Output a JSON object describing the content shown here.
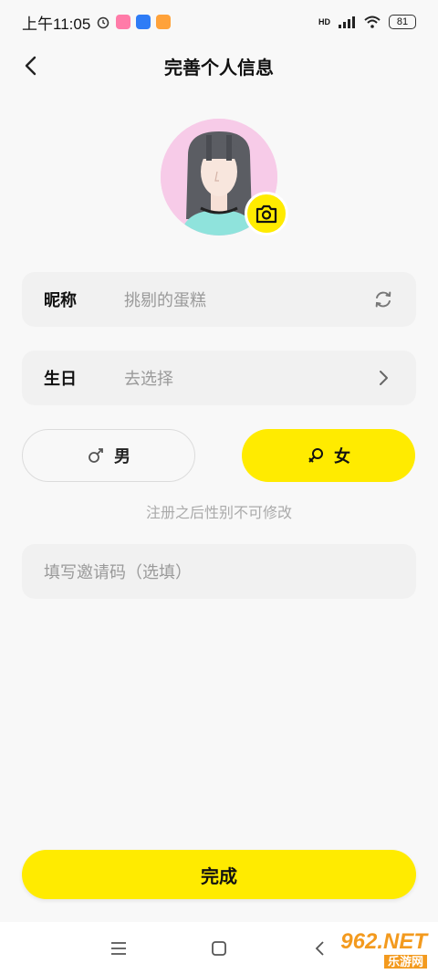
{
  "status_bar": {
    "time": "上午11:05",
    "network": "HD",
    "battery": "81"
  },
  "header": {
    "title": "完善个人信息"
  },
  "form": {
    "nickname_label": "昵称",
    "nickname_value": "挑剔的蛋糕",
    "birthday_label": "生日",
    "birthday_placeholder": "去选择",
    "gender_male": "男",
    "gender_female": "女",
    "gender_selected": "female",
    "gender_hint": "注册之后性别不可修改",
    "invite_placeholder": "填写邀请码（选填）"
  },
  "actions": {
    "submit": "完成"
  },
  "watermark": {
    "main": "962.NET",
    "sub": "乐游网"
  },
  "colors": {
    "accent": "#ffeb00",
    "background": "#f8f8f8",
    "field_bg": "#f1f1f1",
    "hint_text": "#aaaaaa",
    "avatar_bg": "#f7cbe8"
  }
}
